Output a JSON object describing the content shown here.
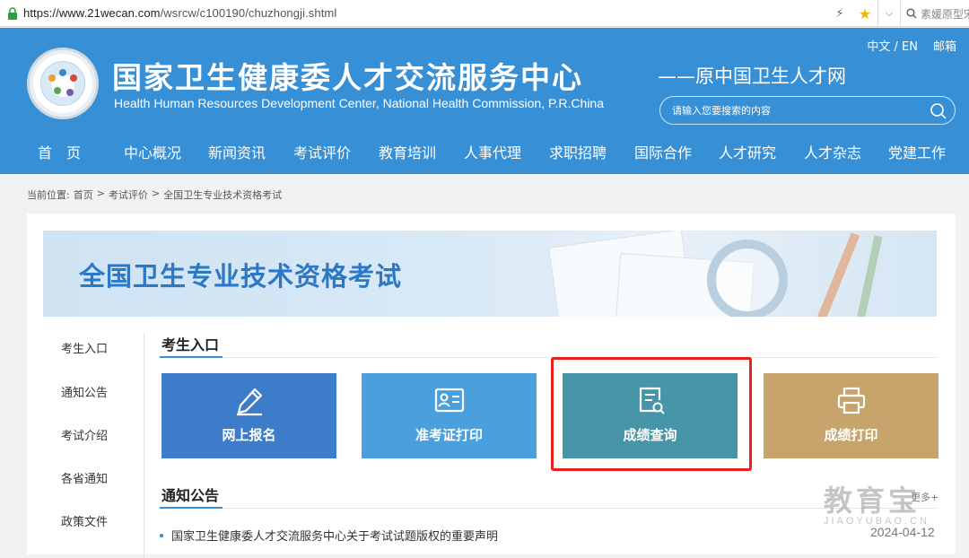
{
  "browser": {
    "url_host": "https://www.21wecan.com",
    "url_path": "/wsrcw/c100190/chuzhongji.shtml",
    "search_text": "素媛原型宋"
  },
  "header": {
    "title": "国家卫生健康委人才交流服务中心",
    "subtitle": "Health Human Resources Development Center, National Health Commission, P.R.China",
    "former_name": "——原中国卫生人才网",
    "lang_label": "中文 / EN",
    "mail_label": "邮箱",
    "search_placeholder": "请输入您要搜索的内容",
    "nav": [
      "首　页",
      "中心概况",
      "新闻资讯",
      "考试评价",
      "教育培训",
      "人事代理",
      "求职招聘",
      "国际合作",
      "人才研究",
      "人才杂志",
      "党建工作"
    ]
  },
  "breadcrumb": {
    "label": "当前位置:",
    "items": [
      "首页",
      "考试评价",
      "全国卫生专业技术资格考试"
    ],
    "separator": ">"
  },
  "banner": {
    "title": "全国卫生专业技术资格考试"
  },
  "sidebar": {
    "items": [
      "考生入口",
      "通知公告",
      "考试介绍",
      "各省通知",
      "政策文件"
    ]
  },
  "entry_section": {
    "heading": "考生入口",
    "tiles": [
      {
        "label": "网上报名",
        "color": "#3d7cc9",
        "icon": "pencil-icon"
      },
      {
        "label": "准考证打印",
        "color": "#4aa0dc",
        "icon": "id-card-icon"
      },
      {
        "label": "成绩查询",
        "color": "#4696a8",
        "icon": "document-search-icon"
      },
      {
        "label": "成绩打印",
        "color": "#c7a46b",
        "icon": "printer-icon"
      }
    ]
  },
  "notice_section": {
    "heading": "通知公告",
    "more_label": "更多+",
    "items": [
      {
        "title": "国家卫生健康委人才交流服务中心关于考试试题版权的重要声明",
        "date": "2024-04-12"
      }
    ]
  },
  "watermark": {
    "big": "教育宝",
    "small": "JIAOYUBAO.CN"
  },
  "colors": {
    "header_bg": "#3790d6",
    "highlight": "#e8221a"
  }
}
